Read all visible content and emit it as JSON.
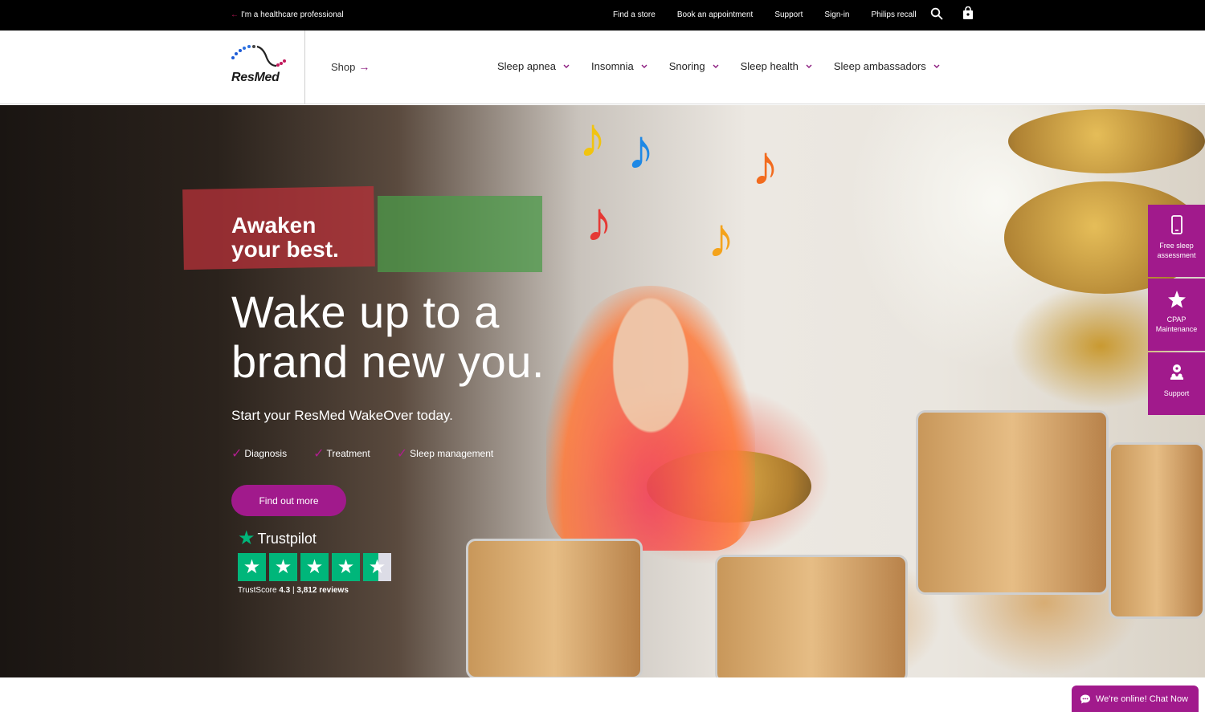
{
  "topbar": {
    "hcp_link": "I'm a healthcare professional",
    "links": [
      "Find a store",
      "Book an appointment",
      "Support",
      "Sign-in",
      "Philips recall"
    ]
  },
  "header": {
    "logo_text": "ResMed",
    "shop_label": "Shop",
    "nav": [
      "Sleep apnea",
      "Insomnia",
      "Snoring",
      "Sleep health",
      "Sleep ambassadors"
    ]
  },
  "hero": {
    "tagline_line1": "Awaken",
    "tagline_line2": "your best.",
    "headline": "Wake up to a brand new you.",
    "subheadline": "Start your ResMed WakeOver today.",
    "checks": [
      "Diagnosis",
      "Treatment",
      "Sleep management"
    ],
    "cta_label": "Find out more"
  },
  "trustpilot": {
    "brand": "Trustpilot",
    "rating": 4.3,
    "score_label": "TrustScore",
    "score_value": "4.3",
    "reviews": "3,812 reviews"
  },
  "side_widgets": {
    "assessment": "Free sleep assessment",
    "cpap": "CPAP Maintenance",
    "support": "Support"
  },
  "chat": {
    "label": "We're online! Chat Now"
  },
  "colors": {
    "brand_purple": "#a11a8c",
    "trustpilot_green": "#00b67a",
    "topbar_bg": "#000000"
  }
}
